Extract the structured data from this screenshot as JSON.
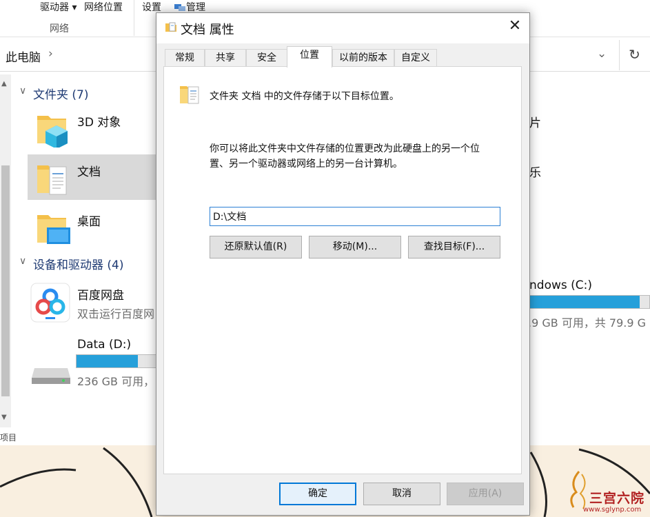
{
  "explorer": {
    "ribbon": {
      "drives_label": "驱动器",
      "network_location_label": "网络位置",
      "group_label": "网络",
      "settings_label": "设置",
      "manage_label": "管理"
    },
    "address": {
      "path": "此电脑",
      "chevron": "›"
    },
    "groups": {
      "folders": "文件夹 (7)",
      "devices": "设备和驱动器 (4)"
    },
    "folders": [
      {
        "label": "3D 对象",
        "icon": "3d-objects-folder-icon"
      },
      {
        "label": "文档",
        "icon": "documents-folder-icon"
      },
      {
        "label": "桌面",
        "icon": "desktop-folder-icon"
      }
    ],
    "right_column": {
      "pictures_fragment": "片",
      "music_fragment": "乐"
    },
    "devices": {
      "baidu": {
        "label": "百度网盘",
        "sub": "双击运行百度网"
      },
      "data_drive": {
        "label": "Data (D:)",
        "sub": "236 GB 可用，",
        "used_fraction": 0.75
      },
      "c_drive": {
        "label": "ndows (C:)",
        "sub": ".9 GB 可用，共 79.9 G",
        "used_fraction": 0.92
      }
    },
    "status": "项目"
  },
  "dialog": {
    "title": "文档 属性",
    "close_glyph": "✕",
    "tabs": [
      "常规",
      "共享",
      "安全",
      "位置",
      "以前的版本",
      "自定义"
    ],
    "active_tab": "位置",
    "info_line": "文件夹 文档 中的文件存储于以下目标位置。",
    "description_line1": "你可以将此文件夹中文件存储的位置更改为此硬盘上的另一个位",
    "description_line2": "置、另一个驱动器或网络上的另一台计算机。",
    "path_value": "D:\\文档",
    "restore_button": "还原默认值(R)",
    "move_button": "移动(M)...",
    "find_target_button": "查找目标(F)...",
    "ok_button": "确定",
    "cancel_button": "取消",
    "apply_button": "应用(A)"
  },
  "watermark": {
    "name": "三宫六院",
    "url": "www.sglynp.com"
  },
  "colors": {
    "accent": "#0078d7",
    "drive_fill": "#26a0da",
    "group_header": "#1e3a73"
  }
}
